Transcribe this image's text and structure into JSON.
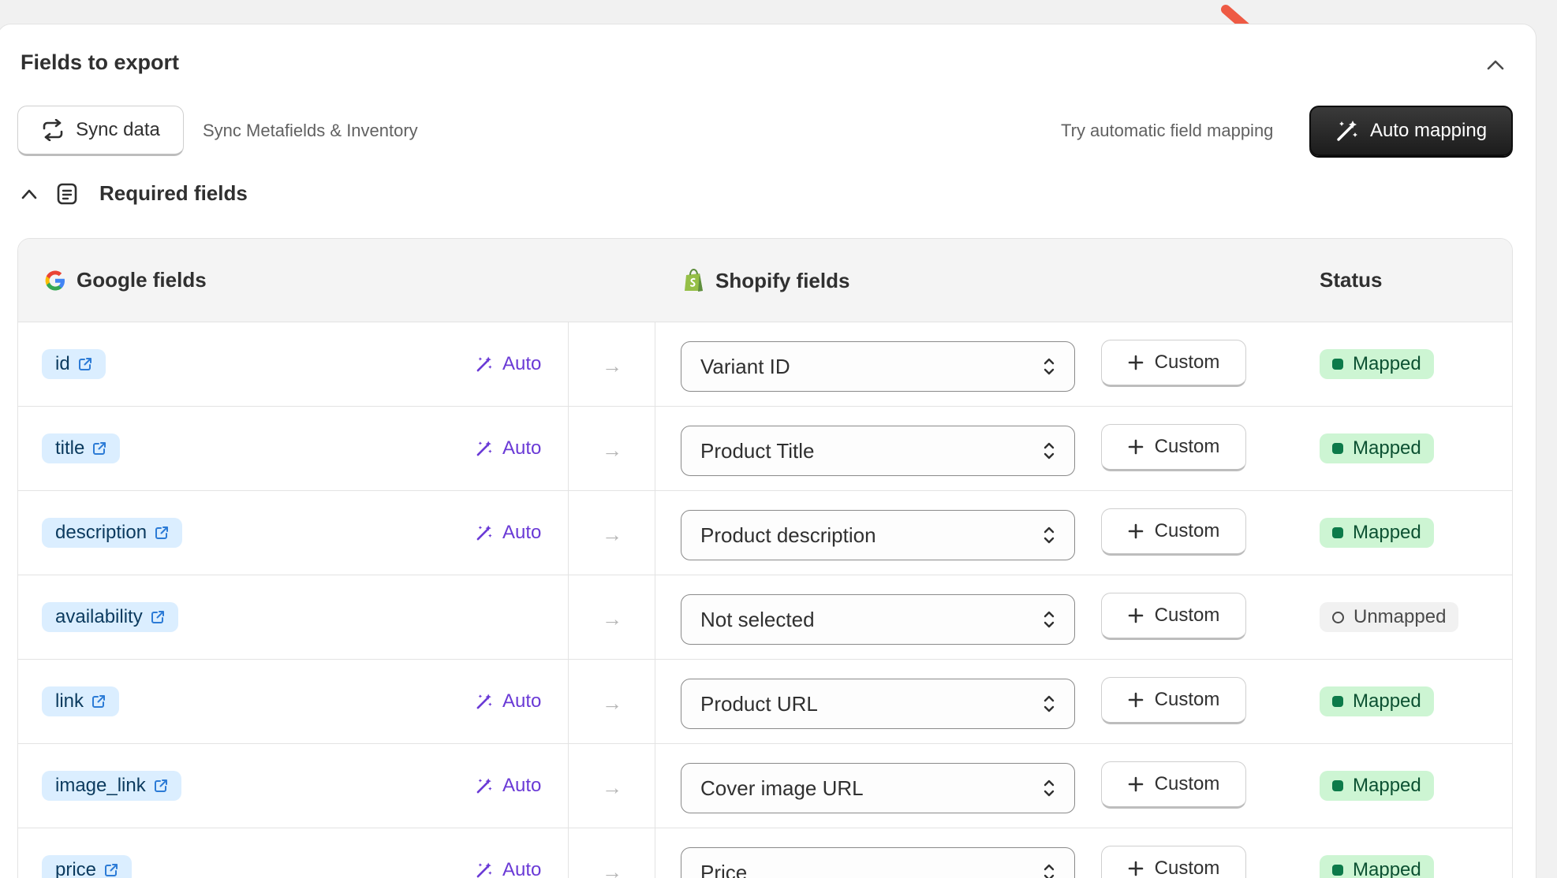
{
  "card": {
    "title": "Fields to export",
    "sync_button_label": "Sync data",
    "sync_subtitle": "Sync Metafields & Inventory",
    "auto_mapping_hint": "Try automatic field mapping",
    "auto_mapping_button_label": "Auto mapping"
  },
  "section": {
    "title": "Required fields"
  },
  "table": {
    "headers": {
      "google": "Google fields",
      "shopify": "Shopify fields",
      "status": "Status"
    },
    "rows": [
      {
        "google_field": "id",
        "auto": "Auto",
        "shopify_field": "Variant ID",
        "custom": "Custom",
        "status": "Mapped"
      },
      {
        "google_field": "title",
        "auto": "Auto",
        "shopify_field": "Product Title",
        "custom": "Custom",
        "status": "Mapped"
      },
      {
        "google_field": "description",
        "auto": "Auto",
        "shopify_field": "Product description",
        "custom": "Custom",
        "status": "Mapped"
      },
      {
        "google_field": "availability",
        "auto": "",
        "shopify_field": "Not selected",
        "custom": "Custom",
        "status": "Unmapped"
      },
      {
        "google_field": "link",
        "auto": "Auto",
        "shopify_field": "Product URL",
        "custom": "Custom",
        "status": "Mapped"
      },
      {
        "google_field": "image_link",
        "auto": "Auto",
        "shopify_field": "Cover image URL",
        "custom": "Custom",
        "status": "Mapped"
      },
      {
        "google_field": "price",
        "auto": "Auto",
        "shopify_field": "Price",
        "custom": "Custom",
        "status": "Mapped"
      }
    ]
  },
  "colors": {
    "accent_auto": "#6a3ad6",
    "mapped_bg": "#cdf5d3",
    "mapped_text": "#0c5132",
    "field_tag_bg": "#dbeeff",
    "annotation_arrow": "#ee5a44"
  },
  "icons": {
    "sync": "refresh-arrows-icon",
    "auto_mapping": "magic-wand-icon",
    "collapse": "chevron-up-icon",
    "required_section": "document-list-icon",
    "google": "google-g-icon",
    "shopify": "shopify-bag-icon",
    "external_link": "external-link-icon",
    "select": "select-chevrons-icon",
    "custom": "plus-icon"
  }
}
